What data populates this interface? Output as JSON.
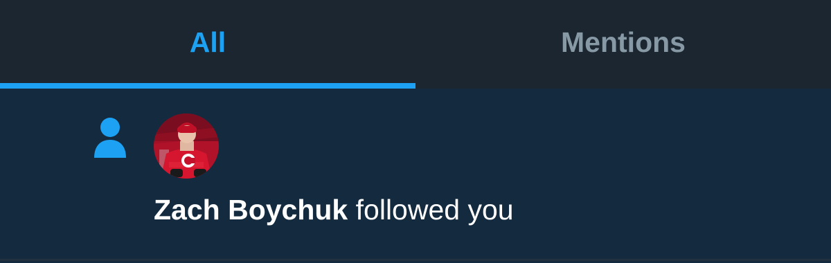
{
  "tabs": {
    "all_label": "All",
    "mentions_label": "Mentions",
    "active": "All"
  },
  "notification": {
    "type_icon": "person-icon",
    "user_name": "Zach Boychuk",
    "action_text": "followed you"
  },
  "colors": {
    "accent": "#1da1f2",
    "inactive_tab": "#8899a6",
    "header_bg": "#1b2631",
    "feed_bg": "#142a3e",
    "text": "#ffffff"
  }
}
